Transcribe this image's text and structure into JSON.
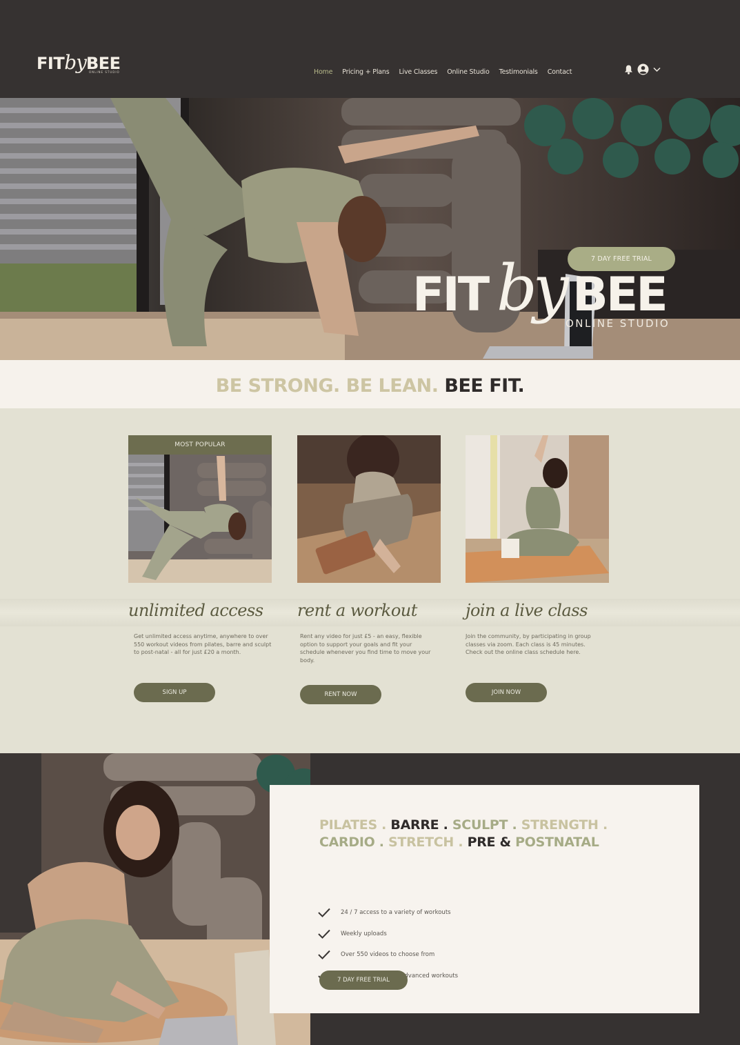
{
  "header": {
    "logo": {
      "fit": "FIT",
      "by": "by",
      "bee": "BEE",
      "sub": "ONLINE STUDIO"
    },
    "nav": [
      {
        "label": "Home",
        "active": true
      },
      {
        "label": "Pricing + Plans"
      },
      {
        "label": "Live Classes"
      },
      {
        "label": "Online Studio"
      },
      {
        "label": "Testimonials"
      },
      {
        "label": "Contact"
      }
    ],
    "icons": [
      "bell-icon",
      "user-icon",
      "chevron-down-icon"
    ]
  },
  "hero": {
    "brand": {
      "fit": "FIT",
      "by": "by",
      "bee": "BEE",
      "studio": "ONLINE STUDIO"
    },
    "cta": "7 DAY FREE TRIAL"
  },
  "tagline": {
    "part1": "BE STRONG. BE LEAN.",
    "part2": "BEE FIT."
  },
  "offers": [
    {
      "badge": "MOST POPULAR",
      "title": "unlimited access",
      "description": "Get unlimited access anytime, anywhere to over 550 workout videos from pilates, barre and sculpt to post-natal - all for just £20 a month.",
      "button": "SIGN UP"
    },
    {
      "title": "rent a workout",
      "description": "Rent any video for just £5 - an easy, flexible option to support your goals and fit your schedule whenever you find time to move your body.",
      "button": "RENT NOW"
    },
    {
      "title": "join a live class",
      "description": "Join the community, by participating in group classes via zoom. Each class is 45 minutes. Check out the online class schedule here.",
      "button": "JOIN NOW"
    }
  ],
  "classes": {
    "line1": [
      {
        "text": "PILATES",
        "tone": "light"
      },
      {
        "text": " . ",
        "tone": "light"
      },
      {
        "text": "BARRE",
        "tone": "dark"
      },
      {
        "text": " . ",
        "tone": "dark"
      },
      {
        "text": "SCULPT",
        "tone": "green"
      },
      {
        "text": " . ",
        "tone": "green"
      },
      {
        "text": "STRENGTH",
        "tone": "light"
      },
      {
        "text": " .",
        "tone": "light"
      }
    ],
    "line2": [
      {
        "text": "CARDIO",
        "tone": "green"
      },
      {
        "text": " . ",
        "tone": "green"
      },
      {
        "text": "STRETCH",
        "tone": "light"
      },
      {
        "text": " . ",
        "tone": "light"
      },
      {
        "text": "PRE & ",
        "tone": "dark"
      },
      {
        "text": "POSTNATAL",
        "tone": "green"
      }
    ]
  },
  "features": [
    "24 / 7 access to a variety of workouts",
    "Weekly uploads",
    "Over 550 videos to choose from",
    "Beginner friendly to advanced workouts"
  ],
  "bottom_cta": "7 DAY FREE TRIAL",
  "colors": {
    "header_bg": "#363231",
    "sage": "#a9ad86",
    "olive_button": "#6b6b4f",
    "cream": "#f6f2ec",
    "section_bg": "#e3e1d3"
  }
}
